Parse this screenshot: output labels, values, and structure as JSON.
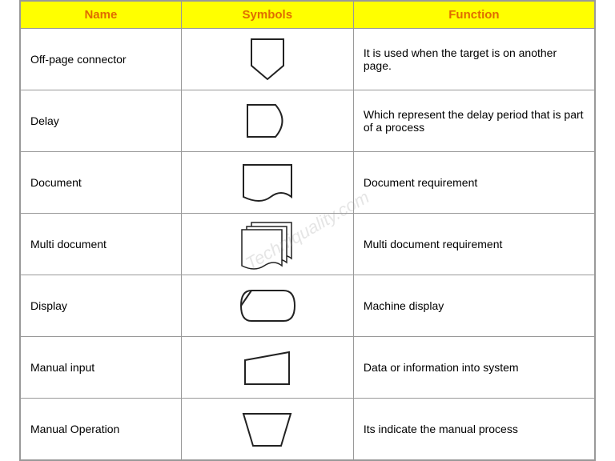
{
  "header": {
    "col1": "Name",
    "col2": "Symbols",
    "col3": "Function"
  },
  "rows": [
    {
      "name": "Off-page connector",
      "symbol_type": "pentagon-down",
      "function": "It is used when the target is on another page."
    },
    {
      "name": "Delay",
      "symbol_type": "delay-shape",
      "function": "Which represent the delay period that is part of a process"
    },
    {
      "name": "Document",
      "symbol_type": "document-shape",
      "function": "Document requirement"
    },
    {
      "name": "Multi document",
      "symbol_type": "multi-document-shape",
      "function": "Multi document requirement"
    },
    {
      "name": "Display",
      "symbol_type": "display-shape",
      "function": "Machine display"
    },
    {
      "name": "Manual input",
      "symbol_type": "manual-input-shape",
      "function": "Data or information into system"
    },
    {
      "name": "Manual Operation",
      "symbol_type": "manual-operation-shape",
      "function": "Its indicate the manual process"
    }
  ],
  "watermark": "Techniquality.com"
}
